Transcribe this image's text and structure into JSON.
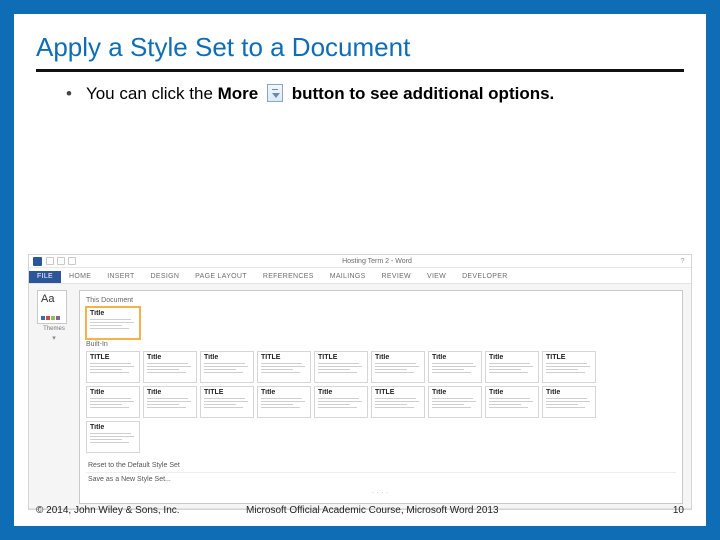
{
  "slide": {
    "title": "Apply a Style Set to a Document",
    "bullet_pre": "You can click the ",
    "bullet_strong": "More",
    "bullet_post": " button  to see additional options.",
    "copyright": "© 2014, John Wiley & Sons, Inc.",
    "course": "Microsoft Official Academic Course, Microsoft Word 2013",
    "page": "10"
  },
  "word": {
    "window_title": "Hosting Term 2 - Word",
    "tabs": [
      "FILE",
      "HOME",
      "INSERT",
      "DESIGN",
      "PAGE LAYOUT",
      "REFERENCES",
      "MAILINGS",
      "REVIEW",
      "VIEW",
      "DEVELOPER"
    ],
    "themes_label": "Themes",
    "swatch_colors": [
      "#3b6ea5",
      "#c0504d",
      "#9bbb59",
      "#8064a2"
    ],
    "group_this": "This Document",
    "group_builtin": "Built-In",
    "this_doc_tile": "Title",
    "builtin_row1": [
      "TITLE",
      "Title",
      "Title",
      "TITLE",
      "TITLE",
      "Title",
      "Title",
      "Title",
      "TITLE"
    ],
    "builtin_row2": [
      "Title",
      "Title",
      "TITLE",
      "Title",
      "Title",
      "TITLE",
      "Title",
      "Title",
      "Title"
    ],
    "builtin_row3": [
      "Title"
    ],
    "menu_reset": "Reset to the Default Style Set",
    "menu_save": "Save as a New Style Set..."
  }
}
